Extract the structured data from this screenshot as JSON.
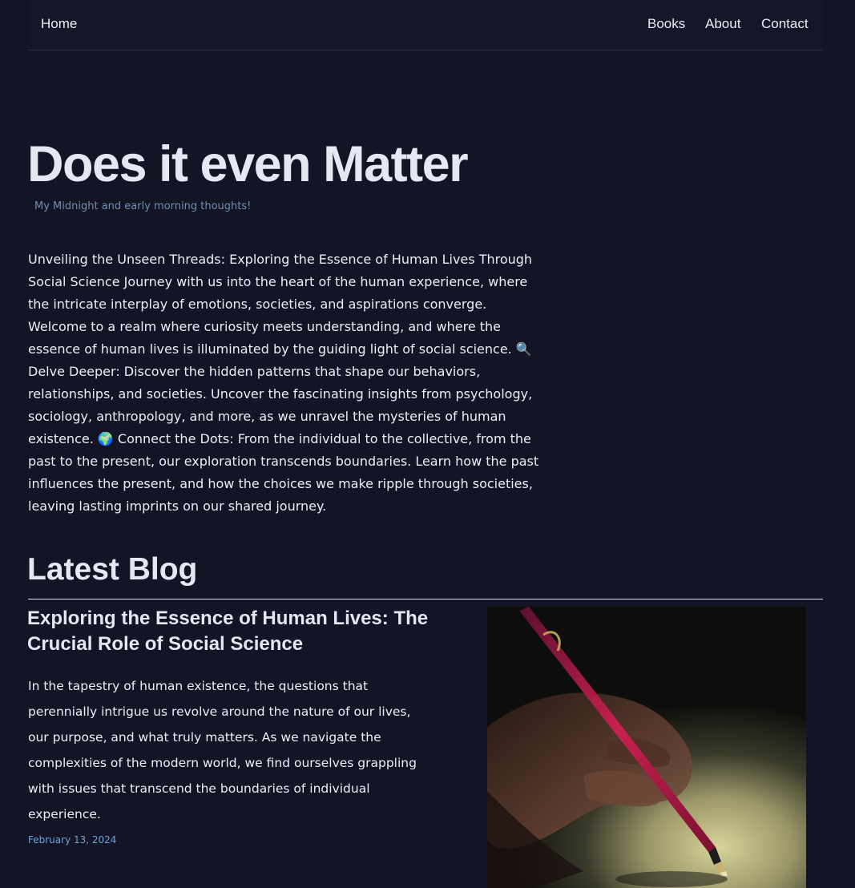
{
  "nav": {
    "home": "Home",
    "books": "Books",
    "about": "About",
    "contact": "Contact"
  },
  "hero": {
    "title": "Does it even Matter",
    "tagline": "My Midnight and early morning thoughts!"
  },
  "intro": {
    "part1": "Unveiling the Unseen Threads: Exploring the Essence of Human Lives Through Social Science Journey with us into the heart of the human experience, where the intricate interplay of emotions, societies, and aspirations converge. Welcome to a realm where curiosity meets understanding, and where the essence of human lives is illuminated by the guiding light of social science.",
    "emoji1": "🔍",
    "part2": "Delve Deeper: Discover the hidden patterns that shape our behaviors, relationships, and societies. Uncover the fascinating insights from psychology, sociology, anthropology, and more, as we unravel the mysteries of human existence.",
    "emoji2": "🌍",
    "part3": "Connect the Dots: From the individual to the collective, from the past to the present, our exploration transcends boundaries. Learn how the past influences the present, and how the choices we make ripple through societies, leaving lasting imprints on our shared journey."
  },
  "latest": {
    "heading": "Latest Blog"
  },
  "post": {
    "title": "Exploring the Essence of Human Lives: The Crucial Role of Social Science",
    "excerpt": "In the tapestry of human existence, the questions that perennially intrigue us revolve around the nature of our lives, our purpose, and what truly matters. As we navigate the complexities of the modern world, we find ourselves grappling with issues that transcend the boundaries of individual experience.",
    "date": "February 13, 2024",
    "image_subject": "hand-writing-with-pen-image"
  }
}
